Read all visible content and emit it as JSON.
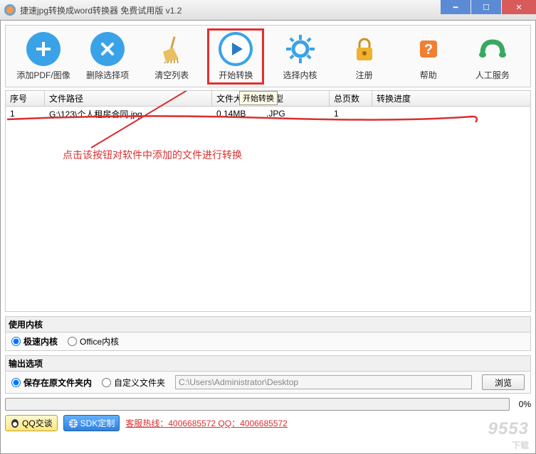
{
  "window": {
    "title": "捷速jpg转换成word转换器 免费试用版 v1.2"
  },
  "toolbar": {
    "add": "添加PDF/图像",
    "delete": "删除选择项",
    "clear": "清空列表",
    "start": "开始转换",
    "kernel": "选择内核",
    "register": "注册",
    "help": "帮助",
    "service": "人工服务",
    "tooltip": "开始转换"
  },
  "table": {
    "headers": {
      "seq": "序号",
      "path": "文件路径",
      "size": "文件大小",
      "type": "类型",
      "pages": "总页数",
      "progress": "转换进度"
    },
    "rows": [
      {
        "seq": "1",
        "path": "G:\\123\\个人租房合同.jpg",
        "size": "0.14MB",
        "type": ".JPG",
        "pages": "1",
        "progress": ""
      }
    ]
  },
  "annotation": "点击该按钮对软件中添加的文件进行转换",
  "kernel_section": {
    "title": "使用内核",
    "fast": "极速内核",
    "office": "Office内核"
  },
  "output_section": {
    "title": "输出选项",
    "same_folder": "保存在原文件夹内",
    "custom": "自定义文件夹",
    "path_placeholder": "C:\\Users\\Administrator\\Desktop",
    "browse": "浏览"
  },
  "progress": {
    "percent": "0%"
  },
  "footer": {
    "qq": "QQ交谈",
    "sdk": "SDK定制",
    "hotline": "客服热线：4006685572 QQ：4006685572"
  },
  "watermark": {
    "main": "9553",
    "sub": "下载"
  }
}
